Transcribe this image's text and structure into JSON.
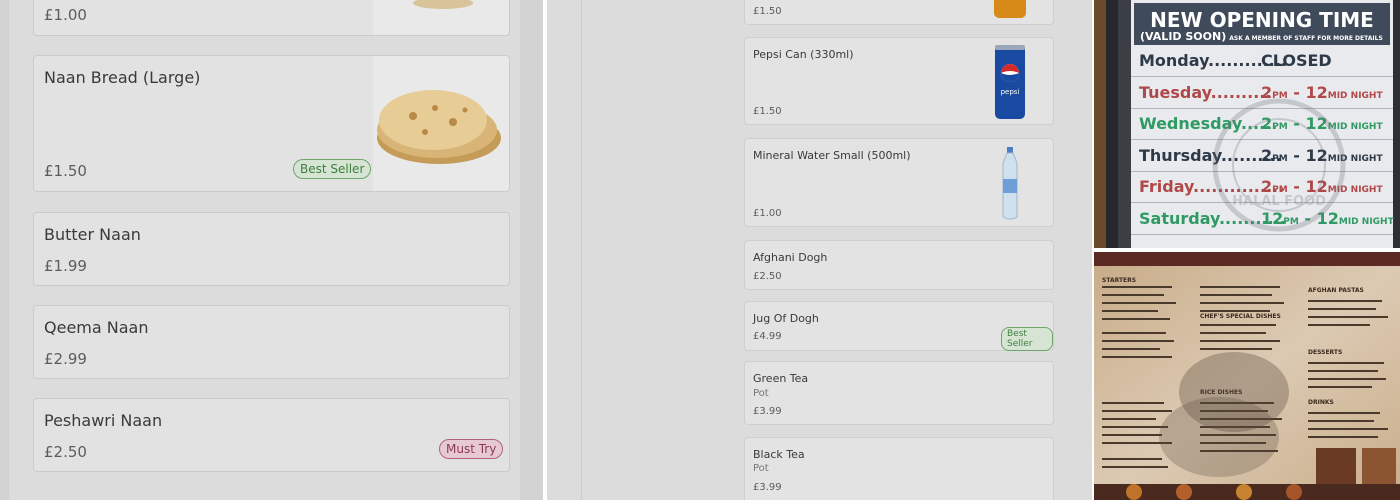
{
  "left_menu": {
    "items": [
      {
        "name": "",
        "price": "£1.00"
      },
      {
        "name": "Naan Bread (Large)",
        "price": "£1.50",
        "badge": "Best Seller"
      },
      {
        "name": "Butter Naan",
        "price": "£1.99"
      },
      {
        "name": "Qeema Naan",
        "price": "£2.99"
      },
      {
        "name": "Peshawri Naan",
        "price": "£2.50",
        "badge": "Must Try"
      }
    ]
  },
  "drinks_menu": {
    "items": [
      {
        "name": "",
        "price": "£1.50"
      },
      {
        "name": "Pepsi Can (330ml)",
        "price": "£1.50",
        "image_label": "pepsi"
      },
      {
        "name": "Mineral Water Small (500ml)",
        "price": "£1.00"
      },
      {
        "name": "Afghani Dogh",
        "price": "£2.50"
      },
      {
        "name": "Jug Of Dogh",
        "price": "£4.99",
        "badge": "Best Seller"
      },
      {
        "name": "Green Tea",
        "subtitle": "Pot",
        "price": "£3.99"
      },
      {
        "name": "Black Tea",
        "subtitle": "Pot",
        "price": "£3.99"
      }
    ]
  },
  "opening_sign": {
    "title": "NEW OPENING TIME",
    "subtitle": "(VALID SOON)",
    "subtitle_note": "ASK A MEMBER OF STAFF FOR MORE DETAILS",
    "rows": [
      {
        "day": "Monday.............",
        "time": "CLOSED",
        "suffix_start": "",
        "suffix_end": "",
        "color": "#2e3a48"
      },
      {
        "day": "Tuesday..........",
        "time": "2",
        "time_end": "12",
        "suffix_start": "PM",
        "suffix_end": "MID NIGHT",
        "color": "#b04848"
      },
      {
        "day": "Wednesday......",
        "time": "2",
        "time_end": "12",
        "suffix_start": "PM",
        "suffix_end": "MID NIGHT",
        "color": "#2f9a63"
      },
      {
        "day": "Thursday..........",
        "time": "2",
        "time_end": "12",
        "suffix_start": "PM",
        "suffix_end": "MID NIGHT",
        "color": "#2e3a48"
      },
      {
        "day": "Friday...............",
        "time": "2",
        "time_end": "12",
        "suffix_start": "PM",
        "suffix_end": "MID NIGHT",
        "color": "#b04848"
      },
      {
        "day": "Saturday...........",
        "time": "12",
        "time_end": "12",
        "suffix_start": "PM",
        "suffix_end": "MID NIGHT",
        "color": "#2f9a63"
      }
    ],
    "watermark_text": "HALAL FOOD"
  },
  "menu_photo": {
    "headings": [
      "STARTERS",
      "AFGHAN PASTAS",
      "CHEF'S SPECIAL DISHES",
      "RICE DISHES",
      "DESSERTS",
      "DRINKS"
    ]
  }
}
